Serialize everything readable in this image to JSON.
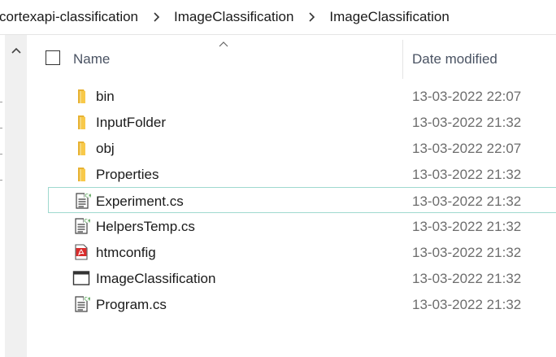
{
  "breadcrumb": [
    "cortexapi-classification",
    "ImageClassification",
    "ImageClassification"
  ],
  "header": {
    "name_label": "Name",
    "date_label": "Date modified",
    "sort": "ascending"
  },
  "colors": {
    "folder": "#f8c94a",
    "selection_border": "#9fd9cf",
    "pdf_red": "#d92b2b"
  },
  "files": [
    {
      "name": "bin",
      "date": "13-03-2022 22:07",
      "icon": "folder-icon"
    },
    {
      "name": "InputFolder",
      "date": "13-03-2022 21:32",
      "icon": "folder-icon"
    },
    {
      "name": "obj",
      "date": "13-03-2022 22:07",
      "icon": "folder-icon"
    },
    {
      "name": "Properties",
      "date": "13-03-2022 21:32",
      "icon": "folder-icon"
    },
    {
      "name": "Experiment.cs",
      "date": "13-03-2022 21:32",
      "icon": "csharp-file-icon",
      "selected": true
    },
    {
      "name": "HelpersTemp.cs",
      "date": "13-03-2022 21:32",
      "icon": "csharp-file-icon"
    },
    {
      "name": "htmconfig",
      "date": "13-03-2022 21:32",
      "icon": "pdf-file-icon"
    },
    {
      "name": "ImageClassification",
      "date": "13-03-2022 21:32",
      "icon": "application-icon"
    },
    {
      "name": "Program.cs",
      "date": "13-03-2022 21:32",
      "icon": "csharp-file-icon"
    }
  ]
}
